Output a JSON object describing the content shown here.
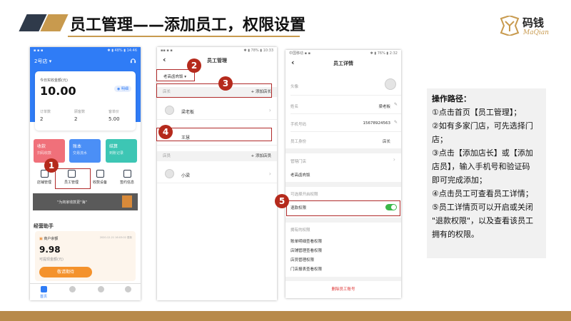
{
  "slide": {
    "title": "员工管理——添加员工，权限设置"
  },
  "logo": {
    "cn": "码钱",
    "en": "MaQian"
  },
  "colors": {
    "gold": "#c89a4e",
    "dark": "#333333",
    "blue": "#2f7cf6",
    "red": "#b02a2a",
    "green": "#3bb84a"
  },
  "phone1": {
    "status_left": "▪ ▪ ▪",
    "status_right": "✱ ▮ 48% ▮ 14:46",
    "store": "2号店",
    "store_chev": "▾",
    "headset_icon": "headset-icon",
    "card": {
      "label": "今日实收金额(元)",
      "amount": "10.00",
      "detail": "明细",
      "stats": [
        {
          "label": "订单数",
          "value": "2"
        },
        {
          "label": "顾客数",
          "value": "2"
        },
        {
          "label": "客单价",
          "value": "5.00"
        }
      ]
    },
    "tiles": [
      {
        "title": "收款",
        "sub": "扫码收款",
        "color": "#f0707a"
      },
      {
        "title": "账本",
        "sub": "交易流水",
        "color": "#4b8ff6"
      },
      {
        "title": "结算",
        "sub": "到账记录",
        "color": "#3dc6b4"
      }
    ],
    "icons": [
      "店铺管理",
      "员工管理",
      "收款设备",
      "签约信息"
    ],
    "banner_text": "\"为商家收款更\"海\"",
    "section": "经营助手",
    "wallet": {
      "label": "商户余额",
      "date": "2020-12-21 16:03:02 更新",
      "amount": "9.98",
      "sub": "可提现金额(元)",
      "button": "敬请期待"
    },
    "nav": [
      "首页",
      "",
      "",
      ""
    ]
  },
  "phone2": {
    "status_left": "▪▪ ▪ ▪",
    "status_right": "✱ ▮ 78% ▮ 10:33",
    "back": "‹",
    "title": "员工管理",
    "store_name": "老高卤肉饭",
    "group1": {
      "label": "店长",
      "add": "+ 添加店长"
    },
    "members1": [
      "梁老板",
      "王慧"
    ],
    "group2": {
      "label": "店员",
      "add": "+ 添加店员"
    },
    "members2": [
      "小梁"
    ]
  },
  "phone3": {
    "status_left": "中国移动 ▪ ▪",
    "status_right": "✱ ▮ 76% ▮ 2:32",
    "back": "‹",
    "title": "员工详情",
    "fields": [
      {
        "label": "头像",
        "value": ""
      },
      {
        "label": "姓名",
        "value": "梁老板"
      },
      {
        "label": "手机号码",
        "value": "15678924563"
      },
      {
        "label": "员工身份",
        "value": "店长"
      }
    ],
    "managed_label": "管辖门店",
    "managed_store": "老高卤肉饭",
    "optional_label": "可选择开启权限",
    "refund_label": "退款权限",
    "owned_label": "拥有的权限",
    "owned": [
      "账单明细查看权限",
      "店铺管理查看权限",
      "店员管理权限",
      "门店报表查看权限"
    ],
    "delete": "删除员工账号"
  },
  "badges": [
    "1",
    "2",
    "3",
    "4",
    "5"
  ],
  "info": {
    "heading": "操作路径：",
    "lines": [
      "①点击首页【员工管理】；",
      "②如有多家门店，可先选择门",
      "店；",
      "③点击【添加店长】或【添加",
      "店员】，输入手机号和验证码",
      "即可完成添加；",
      "④点击员工可查看员工详情；",
      "⑤员工详情页可以开启或关闭",
      "\"退款权限\"，以及查看该员工",
      "拥有的权限。"
    ]
  }
}
